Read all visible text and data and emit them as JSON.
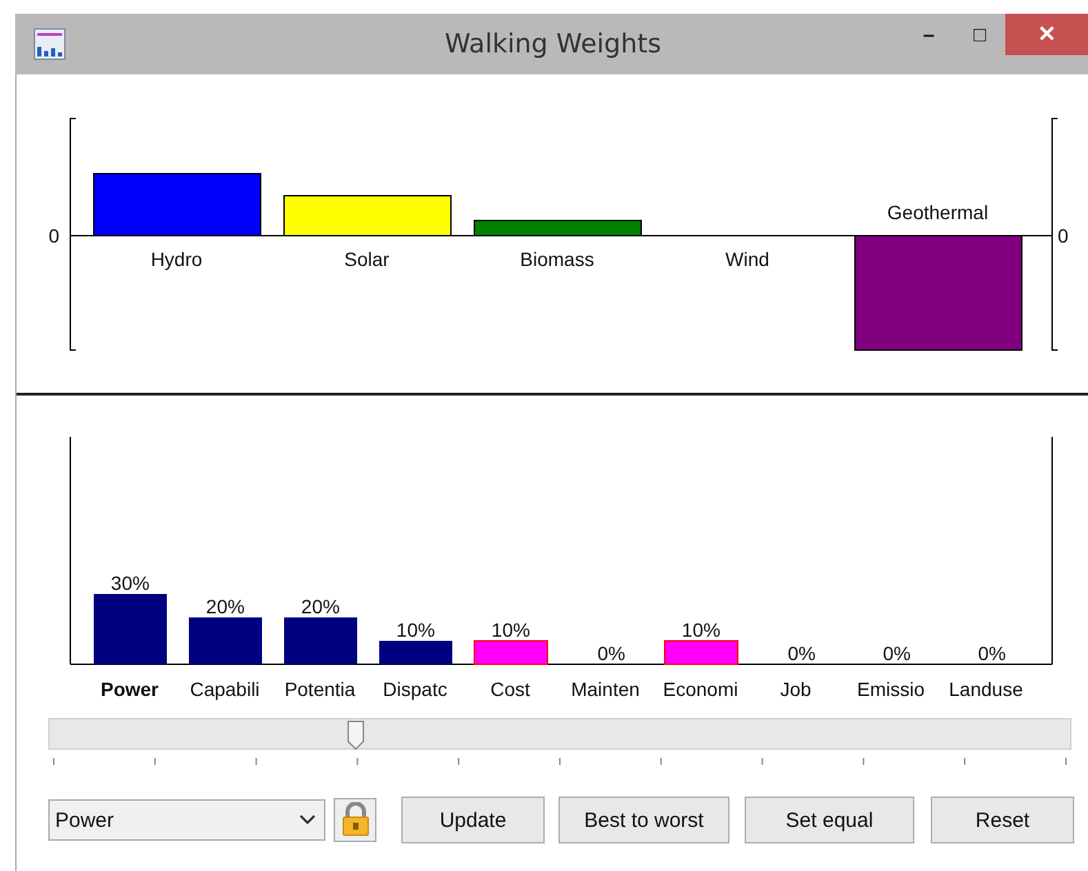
{
  "window": {
    "title": "Walking Weights",
    "controls": [
      "–",
      "□",
      "✕"
    ]
  },
  "alternatives": [
    {
      "label": "Hydro",
      "color": "#0000ff"
    },
    {
      "label": "Solar",
      "color": "#ffff00"
    },
    {
      "label": "Biomass",
      "color": "#008000"
    },
    {
      "label": "Wind"
    },
    {
      "label": "Geothermal",
      "color": "#800080"
    }
  ],
  "alternatives_axis": {
    "left_zero": "0",
    "right_zero": "0"
  },
  "weights": {
    "chart_data": {
      "type": "bar",
      "categories": [
        "Power",
        "Capabili",
        "Potentia",
        "Dispatc",
        "Cost",
        "Mainten",
        "Economi",
        "Job",
        "Emissio",
        "Landuse"
      ],
      "series": [
        {
          "values": [
            30,
            20,
            20,
            10,
            10,
            0,
            10,
            0,
            0,
            0
          ]
        }
      ],
      "data_labels": true
    },
    "value_suffix": "%",
    "criteria": [
      {
        "selected": true,
        "color": "#000080"
      },
      {
        "selected": false,
        "color": "#000080"
      },
      {
        "selected": false,
        "color": "#000080"
      },
      {
        "selected": false,
        "color": "#000080"
      },
      {
        "selected": false,
        "color": "#ff00ff"
      },
      {
        "selected": false
      },
      {
        "selected": false,
        "color": "#ff00ff"
      },
      {
        "selected": false
      },
      {
        "selected": false
      },
      {
        "selected": false
      }
    ]
  },
  "slider": {
    "level": 0.3
  },
  "criterion_select": {
    "value": "Power",
    "locked": true
  },
  "buttons": [
    "Update",
    "Best to worst",
    "Set equal",
    "Reset"
  ]
}
